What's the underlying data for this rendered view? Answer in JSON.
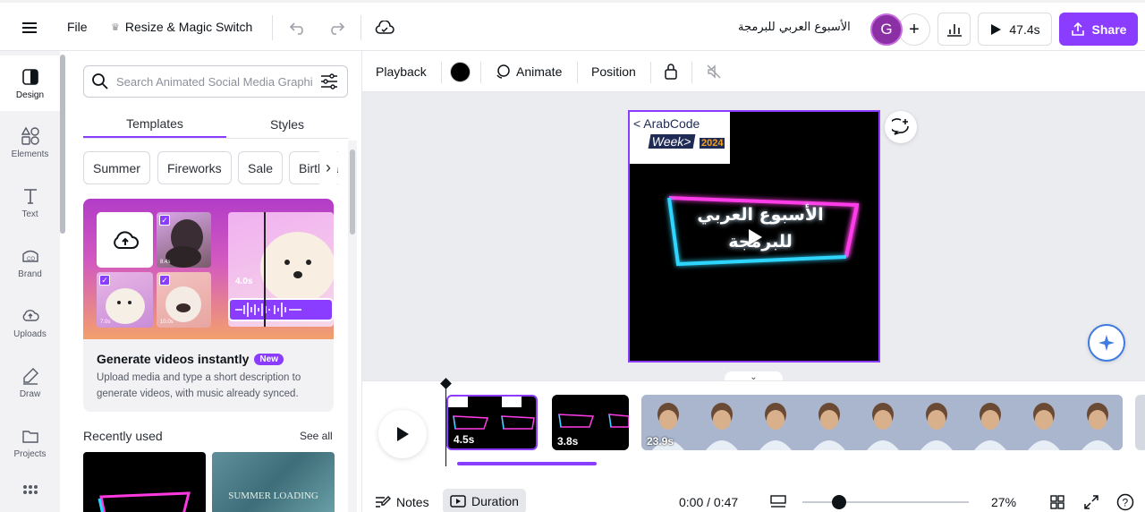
{
  "topbar": {
    "menu_icon": "hamburger-icon",
    "file_label": "File",
    "resize_label": "Resize & Magic Switch",
    "design_title": "الأسبوع العربي للبرمجة",
    "avatar_letter": "G",
    "duration_label": "47.4s",
    "share_label": "Share"
  },
  "rail": {
    "items": [
      {
        "label": "Design",
        "icon": "design-icon"
      },
      {
        "label": "Elements",
        "icon": "elements-icon"
      },
      {
        "label": "Text",
        "icon": "text-icon"
      },
      {
        "label": "Brand",
        "icon": "brand-icon"
      },
      {
        "label": "Uploads",
        "icon": "uploads-icon"
      },
      {
        "label": "Draw",
        "icon": "draw-icon"
      },
      {
        "label": "Projects",
        "icon": "projects-icon"
      },
      {
        "label": "",
        "icon": "apps-icon"
      }
    ]
  },
  "panel": {
    "search_placeholder": "Search Animated Social Media Graphics",
    "tabs": [
      "Templates",
      "Styles"
    ],
    "chips": [
      "Summer",
      "Fireworks",
      "Sale",
      "Birthday"
    ],
    "promo": {
      "title": "Generate videos instantly",
      "badge": "New",
      "description": "Upload media and type a short description to generate videos, with music already synced.",
      "thumb_durations": [
        "8.4s",
        "7.0s",
        "10.0s"
      ],
      "big_duration": "4.0s"
    },
    "recent_title": "Recently used",
    "see_all": "See all",
    "recent_text_2": "SUMMER LOADING"
  },
  "context_toolbar": {
    "playback": "Playback",
    "animate": "Animate",
    "position": "Position",
    "color": "#000000"
  },
  "canvas": {
    "logo_line1": "< ArabCode",
    "logo_line2": "Week>",
    "logo_year": "2024",
    "neon_text": "الأسبوع العربي للبرمجة"
  },
  "timeline": {
    "clips": [
      {
        "duration": "4.5s",
        "selected": true
      },
      {
        "duration": "3.8s",
        "selected": false
      },
      {
        "duration": "23.9s",
        "selected": false
      }
    ]
  },
  "bottombar": {
    "notes": "Notes",
    "duration": "Duration",
    "time": "0:00 / 0:47",
    "zoom": "27%",
    "zoom_level": 0.22
  },
  "colors": {
    "accent": "#8b3dff",
    "avatar": "#8b2fa4"
  }
}
